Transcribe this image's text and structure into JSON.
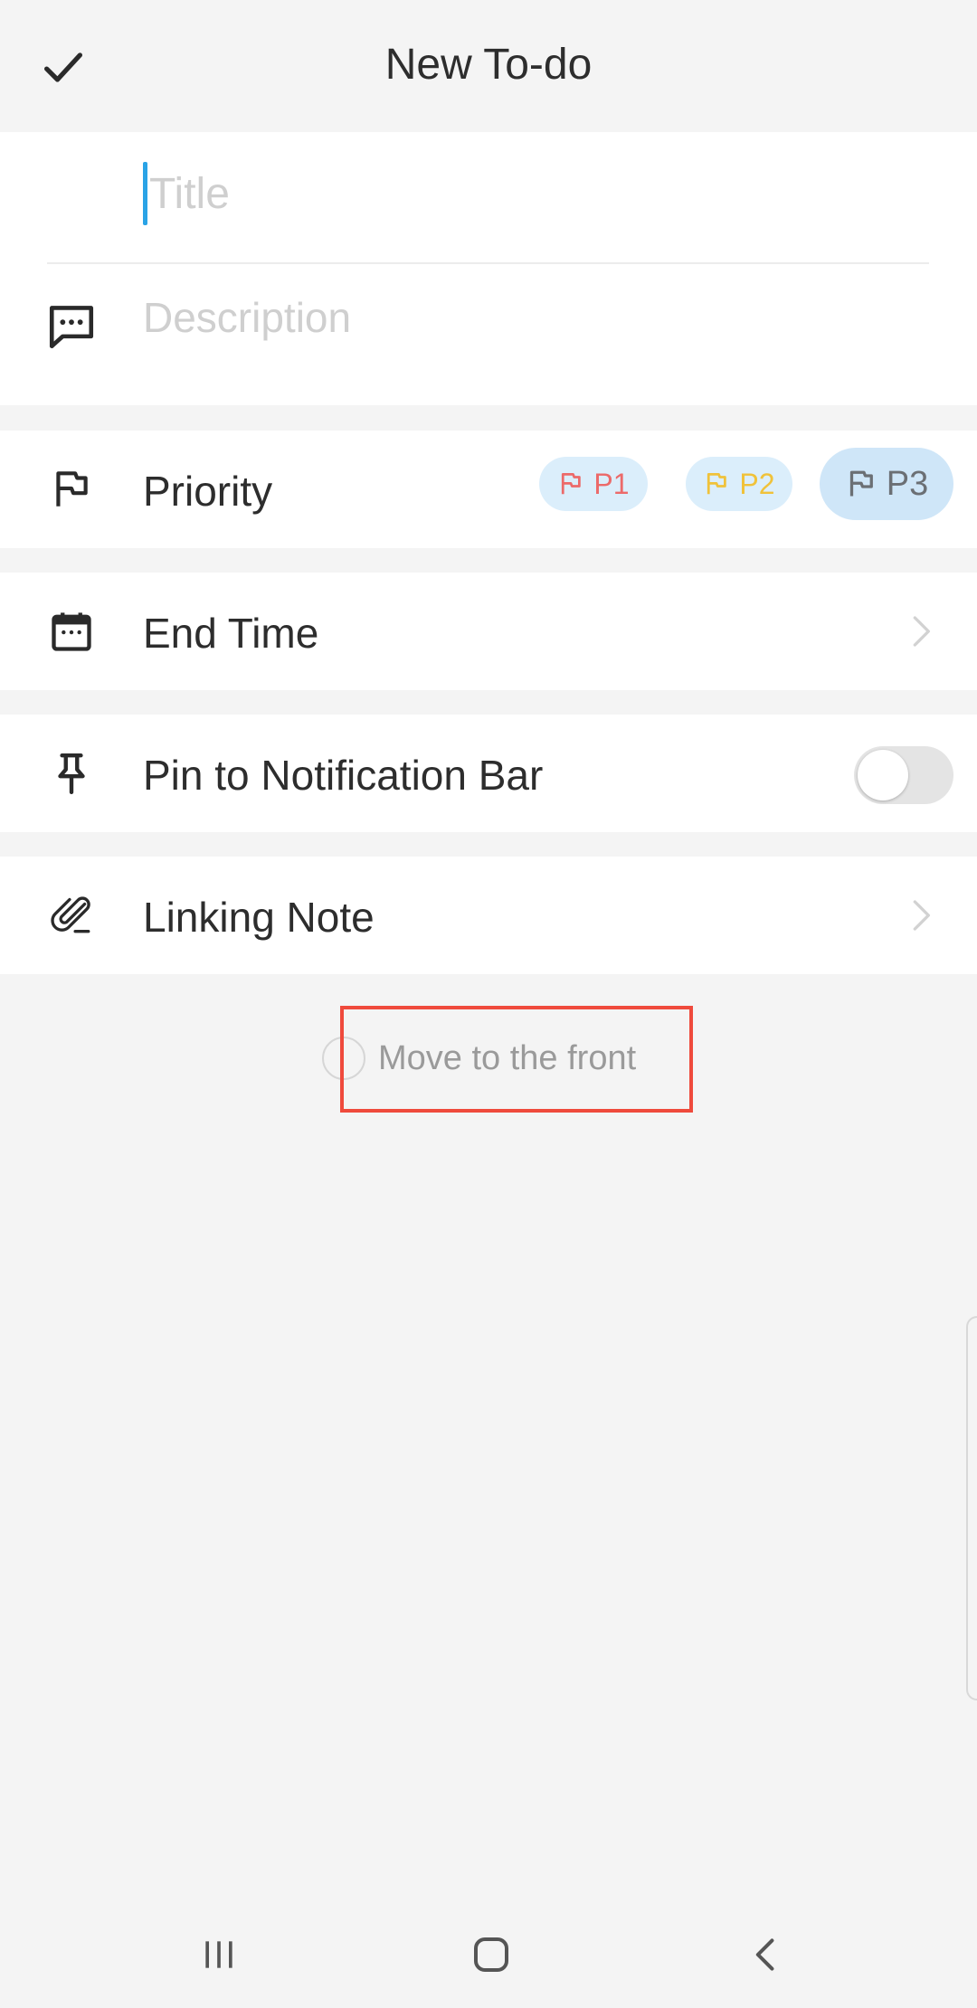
{
  "header": {
    "title": "New To-do",
    "confirm_icon": "check-icon"
  },
  "form": {
    "title_placeholder": "Title",
    "description_placeholder": "Description"
  },
  "priority": {
    "label": "Priority",
    "options": [
      {
        "label": "P1",
        "color": "#ec6a6a"
      },
      {
        "label": "P2",
        "color": "#f0c23a"
      },
      {
        "label": "P3",
        "color": "#6b6f74",
        "selected": true
      }
    ]
  },
  "end_time": {
    "label": "End Time"
  },
  "pin": {
    "label": "Pin to Notification Bar",
    "enabled": false
  },
  "linking_note": {
    "label": "Linking Note"
  },
  "move_front": {
    "label": "Move to the front",
    "checked": false
  },
  "colors": {
    "accent": "#2aa3e6",
    "highlight": "#ef4a3c",
    "background": "#f4f4f4"
  }
}
